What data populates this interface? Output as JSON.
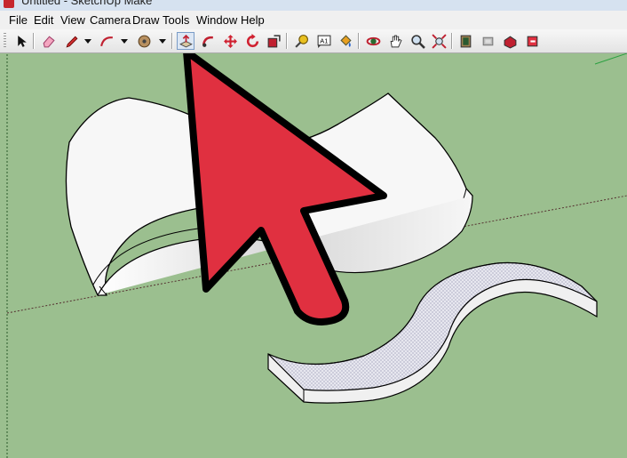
{
  "window": {
    "title": "Untitled - SketchUp Make"
  },
  "menubar": {
    "items": [
      "File",
      "Edit",
      "View",
      "Camera",
      "Draw",
      "Tools",
      "Window",
      "Help"
    ]
  },
  "toolbar": {
    "tools": [
      {
        "icon": "select-arrow-icon"
      },
      {
        "icon": "eraser-icon"
      },
      {
        "icon": "pencil-line-icon"
      },
      {
        "icon": "arc-icon"
      },
      {
        "icon": "shapes-icon"
      },
      {
        "icon": "push-pull-icon",
        "active": true
      },
      {
        "icon": "follow-me-icon"
      },
      {
        "icon": "move-icon"
      },
      {
        "icon": "rotate-icon"
      },
      {
        "icon": "scale-icon"
      },
      {
        "icon": "tape-measure-icon"
      },
      {
        "icon": "text-icon"
      },
      {
        "icon": "paint-bucket-icon"
      },
      {
        "icon": "orbit-icon"
      },
      {
        "icon": "pan-icon"
      },
      {
        "icon": "zoom-icon"
      },
      {
        "icon": "zoom-extents-icon"
      },
      {
        "icon": "warehouse-icon"
      },
      {
        "icon": "share-model-icon"
      },
      {
        "icon": "get-models-icon"
      },
      {
        "icon": "extension-warehouse-icon"
      }
    ],
    "text_tool_label": "A1"
  },
  "viewport": {
    "background_color": "#9bbf8f",
    "model_face_color": "#ffffff",
    "callout_pointer_color": "#e03040"
  }
}
